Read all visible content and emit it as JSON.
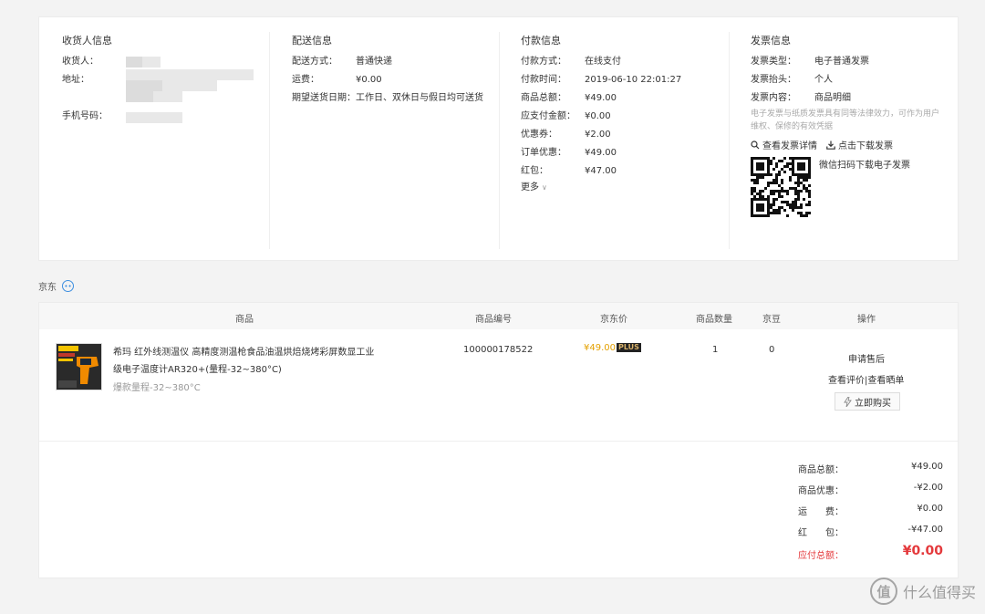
{
  "consignee": {
    "title": "收货人信息",
    "name_label": "收货人：",
    "address_label": "地址：",
    "phone_label": "手机号码："
  },
  "delivery": {
    "title": "配送信息",
    "rows": [
      {
        "label": "配送方式：",
        "value": "普通快递"
      },
      {
        "label": "运费：",
        "value": "¥0.00"
      },
      {
        "label": "期望送货日期：",
        "value": "工作日、双休日与假日均可送货"
      }
    ]
  },
  "payment": {
    "title": "付款信息",
    "rows": [
      {
        "label": "付款方式：",
        "value": "在线支付"
      },
      {
        "label": "付款时间：",
        "value": "2019-06-10 22:01:27"
      },
      {
        "label": "商品总额：",
        "value": "¥49.00"
      },
      {
        "label": "应支付金额：",
        "value": "¥0.00"
      },
      {
        "label": "优惠券：",
        "value": "¥2.00"
      },
      {
        "label": "订单优惠：",
        "value": "¥49.00"
      },
      {
        "label": "红包：",
        "value": "¥47.00"
      }
    ],
    "more": "更多"
  },
  "invoice": {
    "title": "发票信息",
    "rows": [
      {
        "label": "发票类型：",
        "value": "电子普通发票"
      },
      {
        "label": "发票抬头：",
        "value": "个人"
      },
      {
        "label": "发票内容：",
        "value": "商品明细"
      }
    ],
    "note": "电子发票与纸质发票具有同等法律效力，可作为用户维权、保修的有效凭据",
    "view_link": "查看发票详情",
    "download_link": "点击下载发票",
    "qr_caption": "微信扫码下载电子发票"
  },
  "shop": {
    "name": "京东"
  },
  "table": {
    "headers": [
      "商品",
      "商品编号",
      "京东价",
      "商品数量",
      "京豆",
      "操作"
    ]
  },
  "product": {
    "name_line1": "希玛 红外线测温仪 高精度测温枪食品油温烘焙烧烤彩屏数显工业",
    "name_line2": "级电子温度计AR320+(量程-32~380°C)",
    "spec": "爆款量程-32~380°C",
    "sku": "100000178522",
    "price": "¥49.00",
    "plus_badge": "PLUS",
    "quantity": "1",
    "jingdou": "0",
    "action_aftersale": "申请售后",
    "action_review": "查看评价|查看晒单",
    "buy_again": "立即购买"
  },
  "summary": [
    {
      "label": "商品总额：",
      "value": "¥49.00"
    },
    {
      "label": "商品优惠：",
      "value": "-¥2.00"
    },
    {
      "label": "运　　费：",
      "value": "¥0.00"
    },
    {
      "label": "红　　包：",
      "value": "-¥47.00"
    },
    {
      "label": "应付总额：",
      "value": "¥0.00"
    }
  ],
  "watermark": {
    "text": "什么值得买",
    "logo_char": "值"
  },
  "colors": {
    "price": "#e4a000",
    "total_red": "#e4393c",
    "accent_blue": "#3d8fe0"
  }
}
